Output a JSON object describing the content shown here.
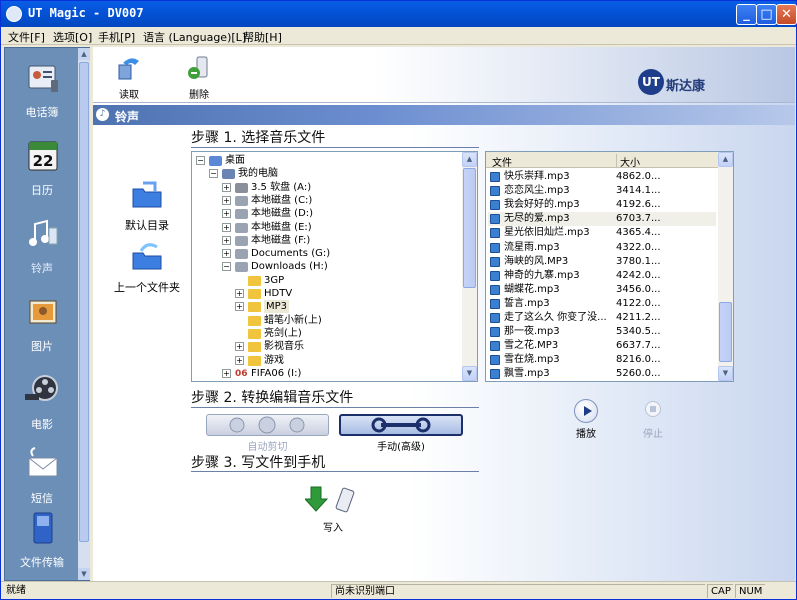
{
  "window": {
    "title": "UT Magic - DV007"
  },
  "menu": [
    "文件[F]",
    "选项[O]",
    "手机[P]",
    "语言 (Language)[L]",
    "帮助[H]"
  ],
  "sidebar": {
    "items": [
      {
        "label": "电话簿",
        "icon": "phonebook-icon"
      },
      {
        "label": "日历",
        "icon": "calendar-icon",
        "date": "22"
      },
      {
        "label": "铃声",
        "icon": "ringtone-icon"
      },
      {
        "label": "图片",
        "icon": "picture-icon"
      },
      {
        "label": "电影",
        "icon": "movie-icon"
      },
      {
        "label": "短信",
        "icon": "sms-icon"
      },
      {
        "label": "文件传输",
        "icon": "file-transfer-icon"
      }
    ]
  },
  "toolbar": {
    "read_label": "读取",
    "delete_label": "删除"
  },
  "logo": {
    "mark": "UT",
    "text": "斯达康"
  },
  "section": {
    "title": "铃声"
  },
  "steps": {
    "step1": "步骤 1. 选择音乐文件",
    "step2": "步骤 2. 转换编辑音乐文件",
    "step3": "步骤 3. 写文件到手机"
  },
  "left_actions": {
    "default_dir": "默认目录",
    "parent_dir": "上一个文件夹"
  },
  "tree": [
    {
      "label": "桌面",
      "level": 0,
      "expander": "−",
      "icon": "desktop"
    },
    {
      "label": "我的电脑",
      "level": 1,
      "expander": "−",
      "icon": "computer"
    },
    {
      "label": "3.5 软盘 (A:)",
      "level": 2,
      "expander": "+",
      "icon": "floppy"
    },
    {
      "label": "本地磁盘 (C:)",
      "level": 2,
      "expander": "+",
      "icon": "drive"
    },
    {
      "label": "本地磁盘 (D:)",
      "level": 2,
      "expander": "+",
      "icon": "drive"
    },
    {
      "label": "本地磁盘 (E:)",
      "level": 2,
      "expander": "+",
      "icon": "drive"
    },
    {
      "label": "本地磁盘 (F:)",
      "level": 2,
      "expander": "+",
      "icon": "drive"
    },
    {
      "label": "Documents (G:)",
      "level": 2,
      "expander": "+",
      "icon": "drive"
    },
    {
      "label": "Downloads (H:)",
      "level": 2,
      "expander": "−",
      "icon": "drive"
    },
    {
      "label": "3GP",
      "level": 3,
      "expander": "",
      "icon": "folder"
    },
    {
      "label": "HDTV",
      "level": 3,
      "expander": "+",
      "icon": "folder"
    },
    {
      "label": "MP3",
      "level": 3,
      "expander": "+",
      "icon": "folder",
      "selected": true
    },
    {
      "label": "蜡笔小新(上)",
      "level": 3,
      "expander": "",
      "icon": "folder"
    },
    {
      "label": "亮剑(上)",
      "level": 3,
      "expander": "",
      "icon": "folder"
    },
    {
      "label": "影视音乐",
      "level": 3,
      "expander": "+",
      "icon": "folder"
    },
    {
      "label": "游戏",
      "level": 3,
      "expander": "+",
      "icon": "folder"
    },
    {
      "label": "FIFA06 (I:)",
      "level": 2,
      "expander": "+",
      "icon": "fifa",
      "badge": "06"
    }
  ],
  "filelist": {
    "columns": [
      "文件",
      "大小"
    ],
    "rows": [
      {
        "name": "快乐崇拜.mp3",
        "size": "4862.0..."
      },
      {
        "name": "恋恋风尘.mp3",
        "size": "3414.1..."
      },
      {
        "name": "我会好好的.mp3",
        "size": "4192.6..."
      },
      {
        "name": "无尽的爱.mp3",
        "size": "6703.7..."
      },
      {
        "name": "星光依旧灿烂.mp3",
        "size": "4365.4..."
      },
      {
        "name": "流星雨.mp3",
        "size": "4322.0..."
      },
      {
        "name": "海峡的风.MP3",
        "size": "3780.1..."
      },
      {
        "name": "神奇的九寨.mp3",
        "size": "4242.0..."
      },
      {
        "name": "蝴蝶花.mp3",
        "size": "3456.0..."
      },
      {
        "name": "誓言.mp3",
        "size": "4122.0..."
      },
      {
        "name": "走了这么久 你变了没...",
        "size": "4211.2..."
      },
      {
        "name": "那一夜.mp3",
        "size": "5340.5..."
      },
      {
        "name": "雪之花.MP3",
        "size": "6637.7..."
      },
      {
        "name": "雪在烧.mp3",
        "size": "8216.0..."
      },
      {
        "name": "飘雪.mp3",
        "size": "5260.0..."
      }
    ]
  },
  "playback": {
    "play_label": "播放",
    "stop_label": "停止"
  },
  "convert": {
    "auto_label": "自动剪切",
    "manual_label": "手动(高级)"
  },
  "write": {
    "label": "写入"
  },
  "status": {
    "ready": "就绪",
    "port": "尚未识别端口",
    "caps": "CAP",
    "num": "NUM"
  }
}
